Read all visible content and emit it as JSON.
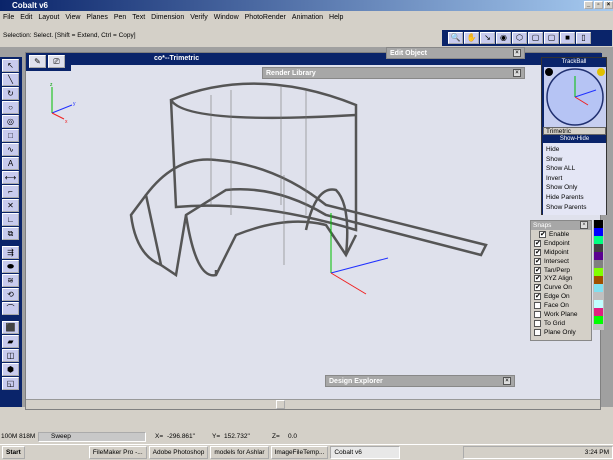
{
  "window": {
    "title": "Cobalt v6",
    "min": "_",
    "max": "▫",
    "close": "×"
  },
  "menu": [
    "File",
    "Edit",
    "Layout",
    "View",
    "Planes",
    "Pen",
    "Text",
    "Dimension",
    "Verify",
    "Window",
    "PhotoRender",
    "Animation",
    "Help"
  ],
  "status_hint": "Selection: Select. [Shift = Extend, Ctrl = Copy]",
  "toolbar": [
    {
      "icon": "zoom-icon",
      "g": "🔍"
    },
    {
      "icon": "pan-hand-icon",
      "g": "✋"
    },
    {
      "icon": "fit-view-icon",
      "g": "↘"
    },
    {
      "icon": "rotate-view-icon",
      "g": "◉"
    },
    {
      "icon": "trimetric-cube-icon",
      "g": "⬡"
    },
    {
      "icon": "wireframe-cube-icon",
      "g": "▢"
    },
    {
      "icon": "hidden-line-cube-icon",
      "g": "▢"
    },
    {
      "icon": "shaded-cube-icon",
      "g": "■"
    },
    {
      "icon": "front-cube-icon",
      "g": "▯"
    }
  ],
  "palette": [
    [
      "select-arrow-icon",
      "line-icon",
      "arc-icon",
      "circle-icon",
      "ellipse-icon",
      "rectangle-icon",
      "spline-icon",
      "text-tool-icon",
      "dimension-icon",
      "fillet-icon",
      "trim-icon",
      "corner-icon",
      "transform-icon"
    ],
    [
      "extrude-icon",
      "sweep-icon",
      "loft-icon",
      "revolve-icon",
      "skin-icon"
    ],
    [
      "box-solid-icon",
      "prism-icon",
      "cylinder-icon",
      "boolean-icon",
      "shell-icon"
    ]
  ],
  "palette_glyphs": [
    "↖",
    "╲",
    "↻",
    "○",
    "◎",
    "□",
    "∿",
    "A",
    "⟷",
    "⌐",
    "✕",
    "∟",
    "⧉",
    "⇶",
    "⬬",
    "≋",
    "⟲",
    "⌒",
    "⬛",
    "▰",
    "◫",
    "⬢",
    "◱"
  ],
  "viewport": {
    "title": "co*--Trimetric",
    "tools": [
      {
        "icon": "pen-tool-icon",
        "g": "✎"
      },
      {
        "icon": "camera-icon",
        "g": "⎚"
      }
    ],
    "axes": {
      "x": "x",
      "y": "y",
      "z": "z"
    }
  },
  "panels": {
    "edit_object": "Edit Object",
    "render_library": "Render Library",
    "design_explorer": "Design Explorer",
    "close": "×"
  },
  "trackball": {
    "title": "TrackBall",
    "view": "Trimetric"
  },
  "show_hide": {
    "title": "Show-Hide",
    "items": [
      "Hide",
      "Show",
      "Show ALL",
      "Invert",
      "Show Only",
      "Hide Parents",
      "Show Parents"
    ]
  },
  "snaps": {
    "title": "Snaps",
    "enable": {
      "label": "Enable",
      "checked": true
    },
    "items": [
      {
        "label": "Endpoint",
        "checked": true
      },
      {
        "label": "Midpoint",
        "checked": true
      },
      {
        "label": "Intersect",
        "checked": true
      },
      {
        "label": "Tan/Perp",
        "checked": true
      },
      {
        "label": "XYZ Align",
        "checked": true
      },
      {
        "label": "Curve On",
        "checked": true
      },
      {
        "label": "Edge On",
        "checked": true
      },
      {
        "label": "Face On",
        "checked": false
      },
      {
        "label": "Work Plane",
        "checked": false
      },
      {
        "label": "To Grid",
        "checked": false
      },
      {
        "label": "Plane Only",
        "checked": false
      }
    ]
  },
  "colors": [
    "#000000",
    "#0000ff",
    "#00ff80",
    "#404040",
    "#5a0090",
    "#808080",
    "#80ff00",
    "#a05000",
    "#80e0f0",
    "#c0c0c0",
    "#c0ffff",
    "#e02080",
    "#00ff00"
  ],
  "statusbar": {
    "memory": "100M  818M",
    "operation": "Sweep",
    "x_label": "X=",
    "x": "-296.861\"",
    "y_label": "Y=",
    "y": "152.732\"",
    "z_label": "Z=",
    "z": "0.0"
  },
  "taskbar": {
    "start": "Start",
    "tasks": [
      "FileMaker Pro -...",
      "Adobe Photoshop",
      "models for Ashlar",
      "ImageFileTemp...",
      "Cobalt v6"
    ],
    "active": "Cobalt v6",
    "clock": "3:24 PM"
  }
}
